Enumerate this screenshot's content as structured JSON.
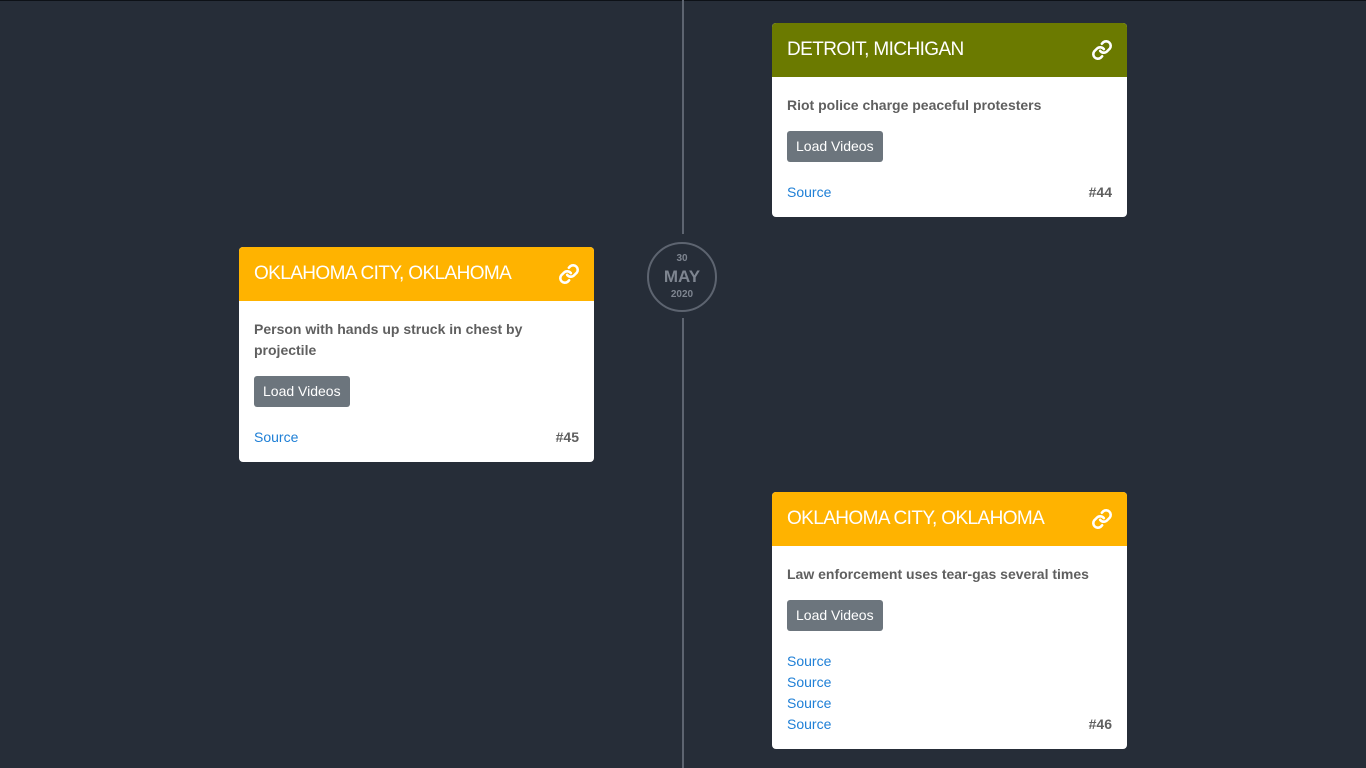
{
  "timeline": {
    "date": {
      "day": "30",
      "month": "MAY",
      "year": "2020"
    }
  },
  "colors": {
    "background": "#262d38",
    "header_olive": "#6b7a00",
    "header_amber": "#ffb300",
    "button": "#6c757d",
    "link": "#1e7fd6"
  },
  "cards": [
    {
      "title": "DETROIT, MICHIGAN",
      "header_color": "#6b7a00",
      "description": "Riot police charge peaceful protesters",
      "button_label": "Load Videos",
      "sources": [
        "Source"
      ],
      "number": "#44",
      "icon": "link-icon"
    },
    {
      "title": "OKLAHOMA CITY, OKLAHOMA",
      "header_color": "#ffb300",
      "description": "Person with hands up struck in chest by projectile",
      "button_label": "Load Videos",
      "sources": [
        "Source"
      ],
      "number": "#45",
      "icon": "link-icon"
    },
    {
      "title": "OKLAHOMA CITY, OKLAHOMA",
      "header_color": "#ffb300",
      "description": "Law enforcement uses tear-gas several times",
      "button_label": "Load Videos",
      "sources": [
        "Source",
        "Source",
        "Source",
        "Source"
      ],
      "number": "#46",
      "icon": "link-icon"
    }
  ]
}
